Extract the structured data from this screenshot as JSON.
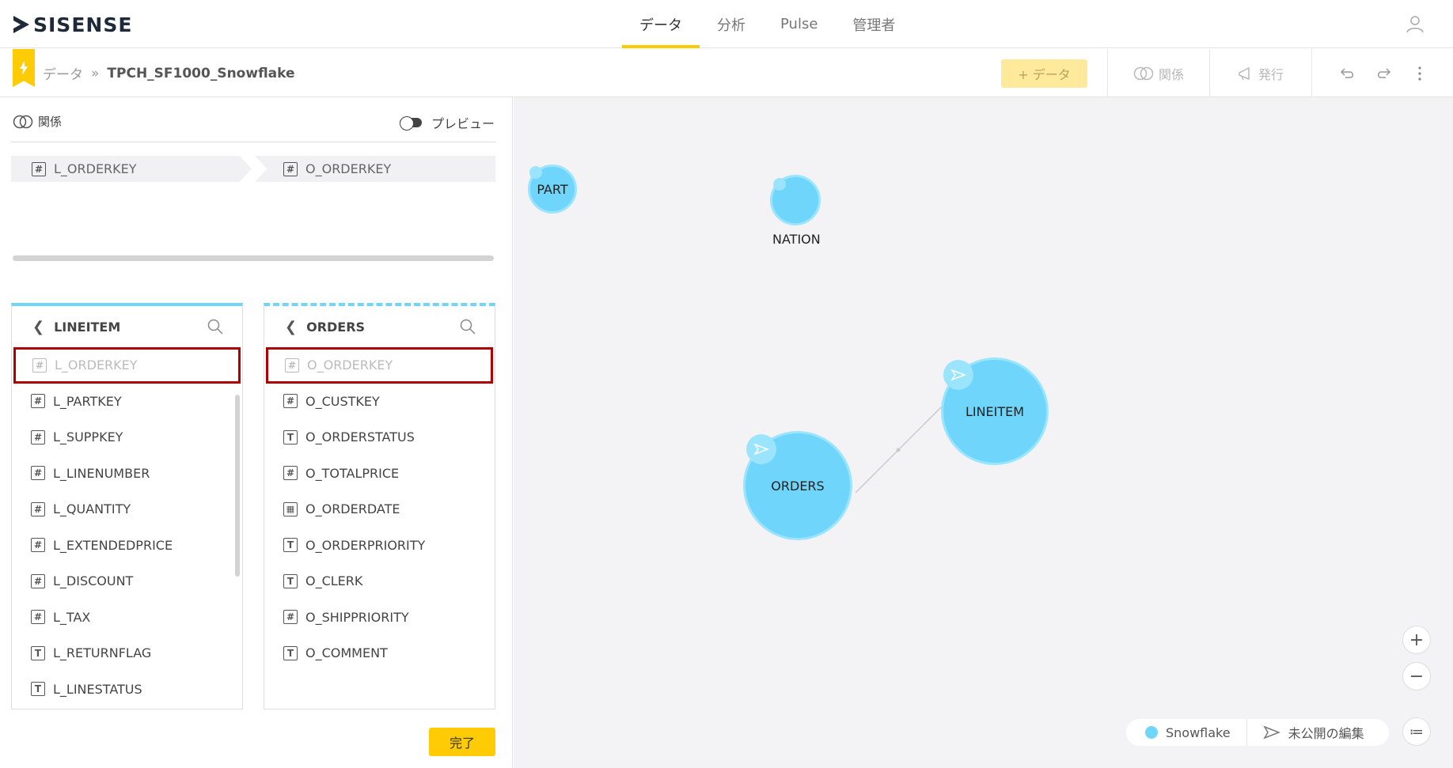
{
  "app": {
    "logo": "SISENSE"
  },
  "nav": {
    "items": [
      "データ",
      "分析",
      "Pulse",
      "管理者"
    ],
    "active": "データ"
  },
  "breadcrumb": {
    "root": "データ",
    "separator": "»",
    "current": "TPCH_SF1000_Snowflake"
  },
  "toolbar": {
    "add_data": "+ データ",
    "relations": "関係",
    "publish": "発行"
  },
  "relation_panel": {
    "title": "関係",
    "preview_label": "プレビュー",
    "left_field": "L_ORDERKEY",
    "right_field": "O_ORDERKEY"
  },
  "tables": {
    "left": {
      "name": "LINEITEM",
      "columns": [
        {
          "name": "L_ORDERKEY",
          "type": "#",
          "selected": true
        },
        {
          "name": "L_PARTKEY",
          "type": "#"
        },
        {
          "name": "L_SUPPKEY",
          "type": "#"
        },
        {
          "name": "L_LINENUMBER",
          "type": "#"
        },
        {
          "name": "L_QUANTITY",
          "type": "#"
        },
        {
          "name": "L_EXTENDEDPRICE",
          "type": "#"
        },
        {
          "name": "L_DISCOUNT",
          "type": "#"
        },
        {
          "name": "L_TAX",
          "type": "#"
        },
        {
          "name": "L_RETURNFLAG",
          "type": "T"
        },
        {
          "name": "L_LINESTATUS",
          "type": "T"
        }
      ]
    },
    "right": {
      "name": "ORDERS",
      "columns": [
        {
          "name": "O_ORDERKEY",
          "type": "#",
          "selected": true
        },
        {
          "name": "O_CUSTKEY",
          "type": "#"
        },
        {
          "name": "O_ORDERSTATUS",
          "type": "T"
        },
        {
          "name": "O_TOTALPRICE",
          "type": "#"
        },
        {
          "name": "O_ORDERDATE",
          "type": "date"
        },
        {
          "name": "O_ORDERPRIORITY",
          "type": "T"
        },
        {
          "name": "O_CLERK",
          "type": "T"
        },
        {
          "name": "O_SHIPPRIORITY",
          "type": "#"
        },
        {
          "name": "O_COMMENT",
          "type": "T"
        }
      ]
    }
  },
  "done_button": "完了",
  "canvas": {
    "nodes": {
      "part": "PART",
      "nation": "NATION",
      "lineitem": "LINEITEM",
      "orders": "ORDERS"
    },
    "legend": {
      "source": "Snowflake",
      "unpublished": "未公開の編集"
    },
    "zoom_in": "+",
    "zoom_out": "−",
    "list": "≔"
  },
  "colors": {
    "accent": "#ffcb05",
    "node": "#6fd5fb",
    "highlight": "#b00000"
  }
}
